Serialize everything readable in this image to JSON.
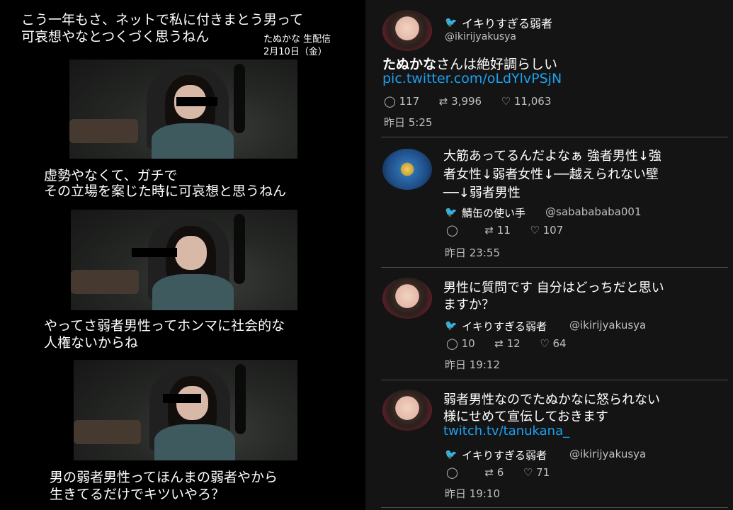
{
  "left": {
    "caption1_line1": "こう一年もさ、ネットで私に付きまとう男って",
    "caption1_line2": "可哀想やなとつくづく思うねん",
    "stream_label": "たぬかな 生配信",
    "stream_date": "2月10日（金）",
    "caption2_line1": "虚勢やなくて、ガチで",
    "caption2_line2": "その立場を案じた時に可哀想と思うねん",
    "caption3_line1": "やってさ弱者男性ってホンマに社会的な",
    "caption3_line2": "人権ないからね",
    "caption4_line1": "男の弱者男性ってほんまの弱者やから",
    "caption4_line2": "生きてるだけでキツいやろ？"
  },
  "main_tweet": {
    "name": "イキりすぎる弱者",
    "handle": "@ikirijyakusya",
    "text_highlight": "たぬかな",
    "text_rest": "さんは絶好調らしい",
    "link": "pic.twitter.com/oLdYlvPSjN",
    "replies": "117",
    "retweets": "3,996",
    "likes": "11,063",
    "time": "昨日 5:25"
  },
  "reply1": {
    "line1": "大筋あってるんだよなぁ 強者男性↓強",
    "line2": "者女性↓弱者女性↓──越えられない壁",
    "line3": "──↓弱者男性",
    "name": "鯖缶の使い手",
    "handle": "@sababababa001",
    "replies": "",
    "retweets": "11",
    "likes": "107",
    "time": "昨日 23:55"
  },
  "reply2": {
    "line1": "男性に質問です 自分はどっちだと思い",
    "line2": "ますか？",
    "name": "イキりすぎる弱者",
    "handle": "@ikirijyakusya",
    "replies": "10",
    "retweets": "12",
    "likes": "64",
    "time": "昨日 19:12"
  },
  "reply3": {
    "line1": "弱者男性なのでたぬかなに怒られない",
    "line2": "様にせめて宣伝しておきます",
    "link": "twitch.tv/tanukana_",
    "name": "イキりすぎる弱者",
    "handle": "@ikirijyakusya",
    "replies": "",
    "retweets": "6",
    "likes": "71",
    "time": "昨日 19:10"
  },
  "icons": {
    "reply": "◯",
    "retweet": "⇄",
    "like": "♡",
    "bird": "twitter-bird-icon"
  },
  "colors": {
    "accent": "#1da1f2",
    "panel": "#141414",
    "meta": "#bfbfbf"
  }
}
